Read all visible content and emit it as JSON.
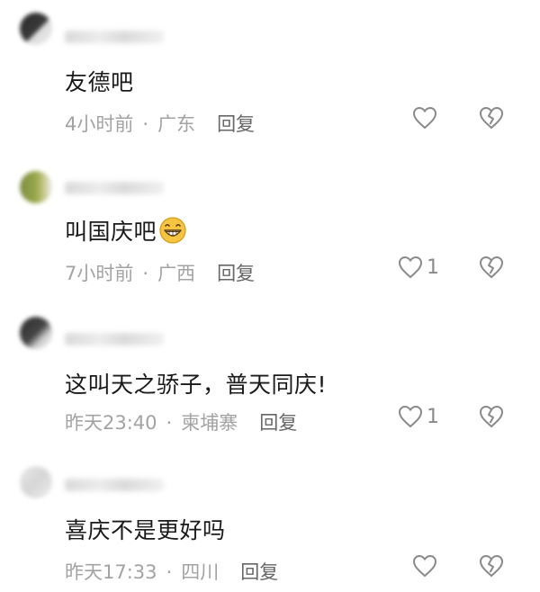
{
  "comments": [
    {
      "text": "友德吧",
      "time": "4小时前",
      "separator": "·",
      "location": "广东",
      "reply_label": "回复",
      "like_count": ""
    },
    {
      "text": "叫国庆吧",
      "emoji": "grinning-face-emoji",
      "time": "7小时前",
      "separator": "·",
      "location": "广西",
      "reply_label": "回复",
      "like_count": "1"
    },
    {
      "text": "这叫天之骄子，普天同庆!",
      "time": "昨天23:40",
      "separator": "·",
      "location": "柬埔寨",
      "reply_label": "回复",
      "like_count": "1"
    },
    {
      "text": "喜庆不是更好吗",
      "time": "昨天17:33",
      "separator": "·",
      "location": "四川",
      "reply_label": "回复",
      "like_count": ""
    }
  ],
  "icons": {
    "like": "heart-outline-icon",
    "dislike": "broken-heart-outline-icon"
  },
  "colors": {
    "text": "#1a1a1a",
    "meta": "#a3a3a3",
    "reply": "#666666",
    "icon": "#8a8a8a",
    "emoji": "#f5c542"
  }
}
